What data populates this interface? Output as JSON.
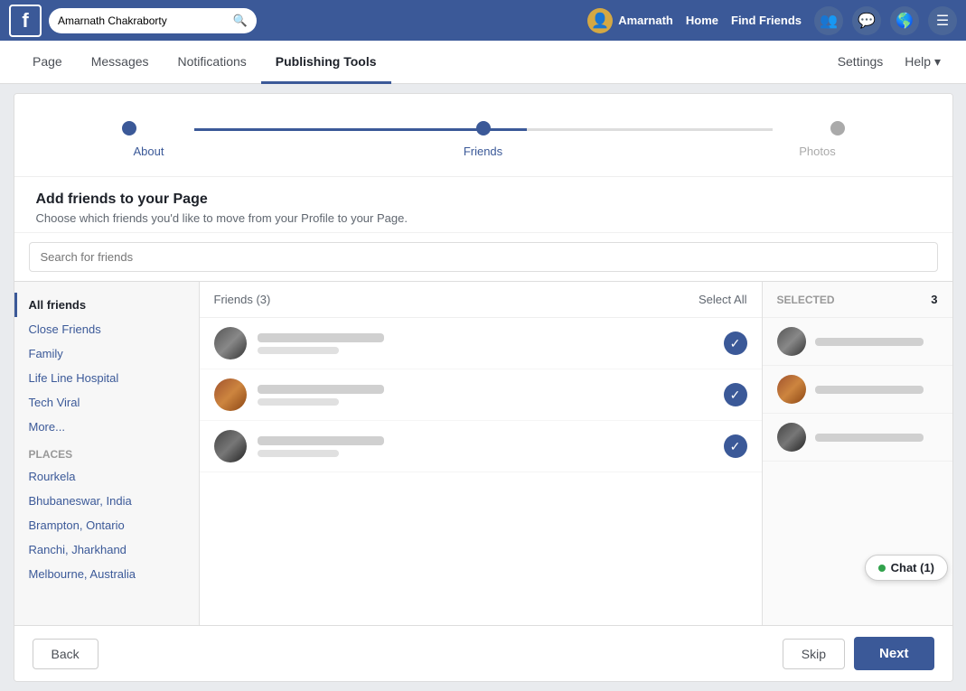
{
  "topnav": {
    "logo": "f",
    "search_placeholder": "Amarnath Chakraborty",
    "user_name": "Amarnath",
    "nav_links": [
      "Home",
      "Find Friends"
    ],
    "chat_label": "Chat (1)"
  },
  "tabs": {
    "items": [
      "Page",
      "Messages",
      "Notifications",
      "Publishing Tools"
    ],
    "active": "Publishing Tools",
    "right": [
      "Settings",
      "Help ▾"
    ]
  },
  "progress": {
    "steps": [
      "About",
      "Friends",
      "Photos"
    ],
    "active_index": 1
  },
  "add_friends": {
    "title": "Add friends to your Page",
    "subtitle": "Choose which friends you'd like to move from your Profile to your Page."
  },
  "search": {
    "placeholder": "Search for friends"
  },
  "sidebar": {
    "active": "All friends",
    "list_items": [
      "All friends",
      "Close Friends",
      "Family",
      "Life Line Hospital",
      "Tech Viral",
      "More..."
    ],
    "places_label": "Places",
    "place_items": [
      "Rourkela",
      "Bhubaneswar, India",
      "Brampton, Ontario",
      "Ranchi, Jharkhand",
      "Melbourne, Australia"
    ]
  },
  "friends_panel": {
    "header": "Friends (3)",
    "select_all": "Select All"
  },
  "selected_panel": {
    "label": "SELECTED",
    "count": "3"
  },
  "buttons": {
    "back": "Back",
    "skip": "Skip",
    "next": "Next"
  }
}
